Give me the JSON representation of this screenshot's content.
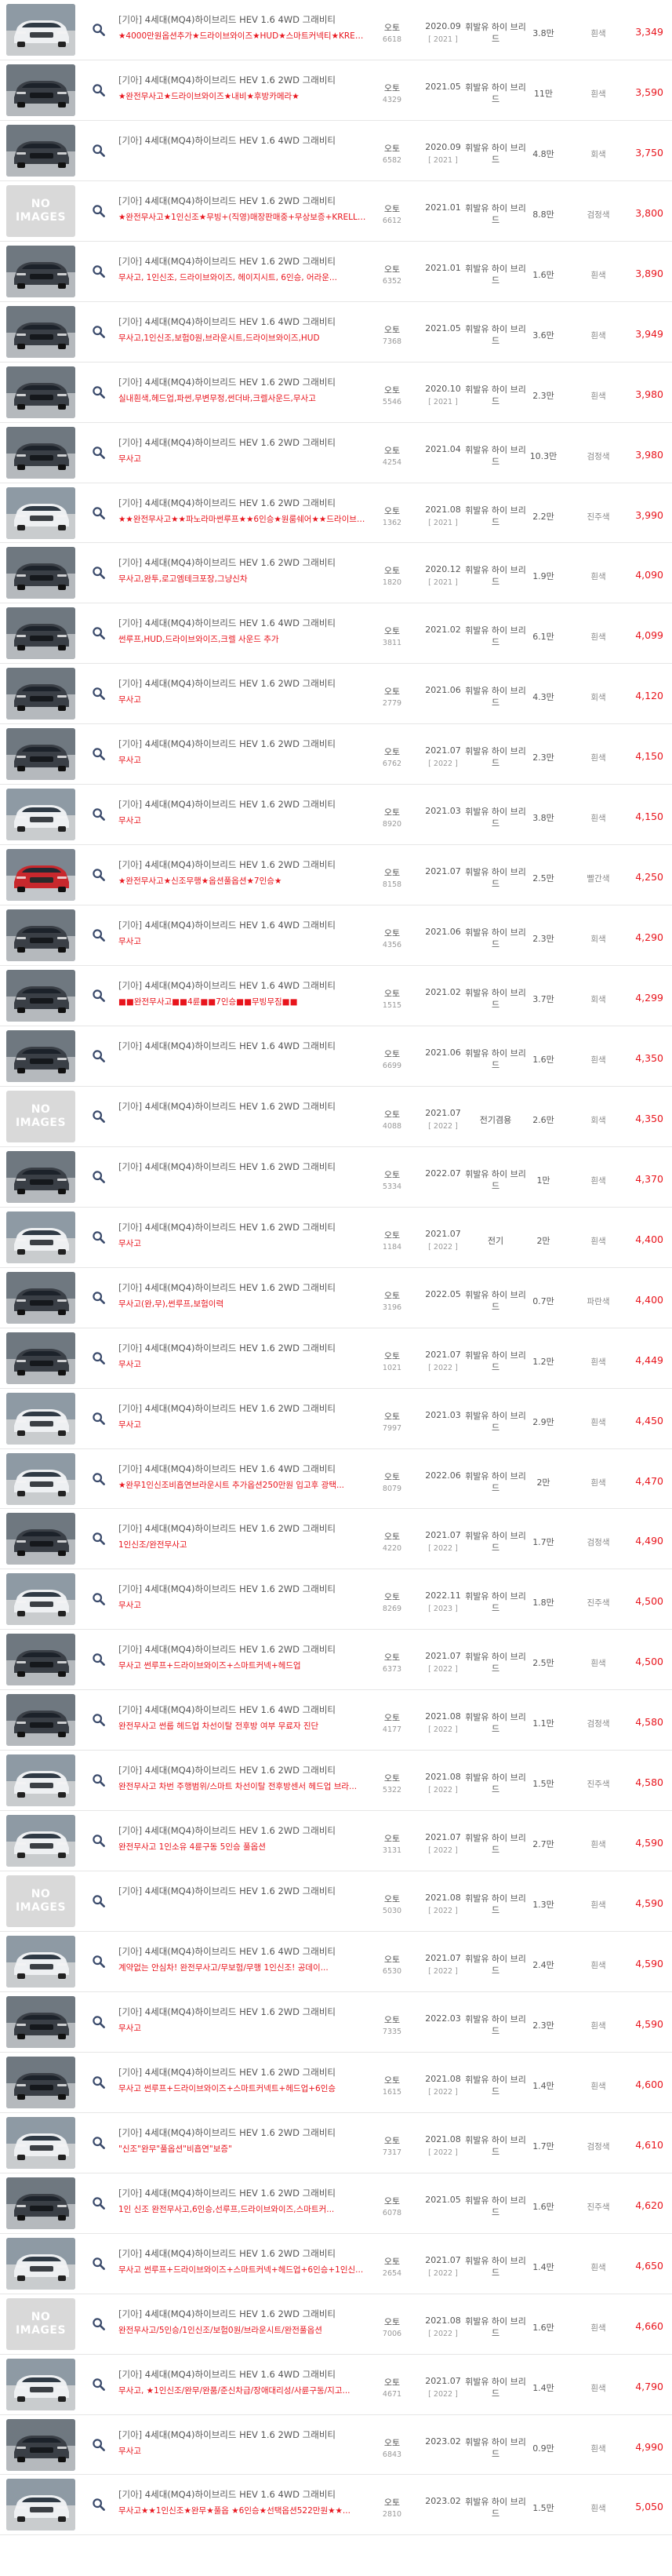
{
  "zoom_icon": "magnifier-icon",
  "no_image": {
    "line1": "NO",
    "line2": "IMAGES"
  },
  "listings": [
    {
      "photo": "white",
      "maker": "[기아]",
      "model": "4세대(MQ4)하이브리드 HEV 1.6 4WD 그래비티",
      "desc": "★4000만원옵션추가★드라이브와이즈★HUD★스마트커넥티★KRELL...",
      "trans": "오토",
      "sub": "6618",
      "year": "2020.09",
      "model_year": "[ 2021 ]",
      "fuel": "휘발유 하이 브리드",
      "km": "3.8만",
      "color": "흰색",
      "price": "3,349"
    },
    {
      "photo": "dark",
      "maker": "[기아]",
      "model": "4세대(MQ4)하이브리드 HEV 1.6 2WD 그래비티",
      "desc": "★완전무사고★드라이브와이즈★내비★후방카메라★",
      "trans": "오토",
      "sub": "4329",
      "year": "2021.05",
      "model_year": "",
      "fuel": "휘발유 하이 브리드",
      "km": "11만",
      "color": "흰색",
      "price": "3,590"
    },
    {
      "photo": "dark",
      "maker": "[기아]",
      "model": "4세대(MQ4)하이브리드 HEV 1.6 4WD 그래비티",
      "desc": "",
      "trans": "오토",
      "sub": "6582",
      "year": "2020.09",
      "model_year": "[ 2021 ]",
      "fuel": "휘발유 하이 브리드",
      "km": "4.8만",
      "color": "회색",
      "price": "3,750"
    },
    {
      "photo": "none",
      "maker": "[기아]",
      "model": "4세대(MQ4)하이브리드 HEV 1.6 2WD 그래비티",
      "desc": "★완전무사고★1인신조★무빙+(직영)매장판매중+무상보증+KRELL(디지털키포...",
      "trans": "오토",
      "sub": "6612",
      "year": "2021.01",
      "model_year": "",
      "fuel": "휘발유 하이 브리드",
      "km": "8.8만",
      "color": "검정색",
      "price": "3,800"
    },
    {
      "photo": "dark",
      "maker": "[기아]",
      "model": "4세대(MQ4)하이브리드 HEV 1.6 2WD 그래비티",
      "desc": "무사고, 1인신조, 드라이브와이즈, 헤이지시트, 6인승, 어라운...",
      "trans": "오토",
      "sub": "6352",
      "year": "2021.01",
      "model_year": "",
      "fuel": "휘발유 하이 브리드",
      "km": "1.6만",
      "color": "흰색",
      "price": "3,890"
    },
    {
      "photo": "dark",
      "maker": "[기아]",
      "model": "4세대(MQ4)하이브리드 HEV 1.6 4WD 그래비티",
      "desc": "무사고,1인신조,보험0원,브라운시트,드라이브와이즈,HUD",
      "trans": "오토",
      "sub": "7368",
      "year": "2021.05",
      "model_year": "",
      "fuel": "휘발유 하이 브리드",
      "km": "3.6만",
      "color": "흰색",
      "price": "3,949"
    },
    {
      "photo": "dark",
      "maker": "[기아]",
      "model": "4세대(MQ4)하이브리드 HEV 1.6 2WD 그래비티",
      "desc": "실내흰색,헤드업,파썬,무변무정,썬더바,크렐사운드,무사고",
      "trans": "오토",
      "sub": "5546",
      "year": "2020.10",
      "model_year": "[ 2021 ]",
      "fuel": "휘발유 하이 브리드",
      "km": "2.3만",
      "color": "흰색",
      "price": "3,980"
    },
    {
      "photo": "dark",
      "maker": "[기아]",
      "model": "4세대(MQ4)하이브리드 HEV 1.6 2WD 그래비티",
      "desc": "무사고",
      "trans": "오토",
      "sub": "4254",
      "year": "2021.04",
      "model_year": "",
      "fuel": "휘발유 하이 브리드",
      "km": "10.3만",
      "color": "검정색",
      "price": "3,980"
    },
    {
      "photo": "white",
      "maker": "[기아]",
      "model": "4세대(MQ4)하이브리드 HEV 1.6 2WD 그래비티",
      "desc": "★★완전무사고★★파노라마썬루프★★6인승★원룸쉐어★★드라이브와이...",
      "trans": "오토",
      "sub": "1362",
      "year": "2021.08",
      "model_year": "[ 2021 ]",
      "fuel": "휘발유 하이 브리드",
      "km": "2.2만",
      "color": "진주색",
      "price": "3,990"
    },
    {
      "photo": "dark",
      "maker": "[기아]",
      "model": "4세대(MQ4)하이브리드 HEV 1.6 2WD 그래비티",
      "desc": "무사고,완투,로고엠테크포장,그냥신차",
      "trans": "오토",
      "sub": "1820",
      "year": "2020.12",
      "model_year": "[ 2021 ]",
      "fuel": "휘발유 하이 브리드",
      "km": "1.9만",
      "color": "흰색",
      "price": "4,090"
    },
    {
      "photo": "dark",
      "maker": "[기아]",
      "model": "4세대(MQ4)하이브리드 HEV 1.6 4WD 그래비티",
      "desc": "썬루프,HUD,드라이브와이즈,크렐 사운드 추가",
      "trans": "오토",
      "sub": "3811",
      "year": "2021.02",
      "model_year": "",
      "fuel": "휘발유 하이 브리드",
      "km": "6.1만",
      "color": "흰색",
      "price": "4,099"
    },
    {
      "photo": "dark",
      "maker": "[기아]",
      "model": "4세대(MQ4)하이브리드 HEV 1.6 2WD 그래비티",
      "desc": "무사고",
      "trans": "오토",
      "sub": "2779",
      "year": "2021.06",
      "model_year": "",
      "fuel": "휘발유 하이 브리드",
      "km": "4.3만",
      "color": "회색",
      "price": "4,120"
    },
    {
      "photo": "dark",
      "maker": "[기아]",
      "model": "4세대(MQ4)하이브리드 HEV 1.6 2WD 그래비티",
      "desc": "무사고",
      "trans": "오토",
      "sub": "6762",
      "year": "2021.07",
      "model_year": "[ 2022 ]",
      "fuel": "휘발유 하이 브리드",
      "km": "2.3만",
      "color": "흰색",
      "price": "4,150"
    },
    {
      "photo": "white",
      "maker": "[기아]",
      "model": "4세대(MQ4)하이브리드 HEV 1.6 2WD 그래비티",
      "desc": "무사고",
      "trans": "오토",
      "sub": "8920",
      "year": "2021.03",
      "model_year": "",
      "fuel": "휘발유 하이 브리드",
      "km": "3.8만",
      "color": "흰색",
      "price": "4,150"
    },
    {
      "photo": "red",
      "maker": "[기아]",
      "model": "4세대(MQ4)하이브리드 HEV 1.6 2WD 그래비티",
      "desc": "★완전무사고★신조무행★옵션풀옵션★7인승★",
      "trans": "오토",
      "sub": "8158",
      "year": "2021.07",
      "model_year": "",
      "fuel": "휘발유 하이 브리드",
      "km": "2.5만",
      "color": "빨간색",
      "price": "4,250"
    },
    {
      "photo": "dark",
      "maker": "[기아]",
      "model": "4세대(MQ4)하이브리드 HEV 1.6 4WD 그래비티",
      "desc": "무사고",
      "trans": "오토",
      "sub": "4356",
      "year": "2021.06",
      "model_year": "",
      "fuel": "휘발유 하이 브리드",
      "km": "2.3만",
      "color": "회색",
      "price": "4,290"
    },
    {
      "photo": "dark",
      "maker": "[기아]",
      "model": "4세대(MQ4)하이브리드 HEV 1.6 4WD 그래비티",
      "desc": "■■완전무사고■■4륜■■7인승■■무빙무짐■■",
      "trans": "오토",
      "sub": "1515",
      "year": "2021.02",
      "model_year": "",
      "fuel": "휘발유 하이 브리드",
      "km": "3.7만",
      "color": "회색",
      "price": "4,299"
    },
    {
      "photo": "dark",
      "maker": "[기아]",
      "model": "4세대(MQ4)하이브리드 HEV 1.6 4WD 그래비티",
      "desc": "",
      "trans": "오토",
      "sub": "6699",
      "year": "2021.06",
      "model_year": "",
      "fuel": "휘발유 하이 브리드",
      "km": "1.6만",
      "color": "흰색",
      "price": "4,350"
    },
    {
      "photo": "none",
      "maker": "[기아]",
      "model": "4세대(MQ4)하이브리드 HEV 1.6 2WD 그래비티",
      "desc": "",
      "trans": "오토",
      "sub": "4088",
      "year": "2021.07",
      "model_year": "[ 2022 ]",
      "fuel": "전기겸용",
      "km": "2.6만",
      "color": "회색",
      "price": "4,350"
    },
    {
      "photo": "dark",
      "maker": "[기아]",
      "model": "4세대(MQ4)하이브리드 HEV 1.6 2WD 그래비티",
      "desc": "",
      "trans": "오토",
      "sub": "5334",
      "year": "2022.07",
      "model_year": "",
      "fuel": "휘발유 하이 브리드",
      "km": "1만",
      "color": "흰색",
      "price": "4,370"
    },
    {
      "photo": "white",
      "maker": "[기아]",
      "model": "4세대(MQ4)하이브리드 HEV 1.6 2WD 그래비티",
      "desc": "무사고",
      "trans": "오토",
      "sub": "1184",
      "year": "2021.07",
      "model_year": "[ 2022 ]",
      "fuel": "전기",
      "km": "2만",
      "color": "흰색",
      "price": "4,400"
    },
    {
      "photo": "dark",
      "maker": "[기아]",
      "model": "4세대(MQ4)하이브리드 HEV 1.6 2WD 그래비티",
      "desc": "무사고(완,무),썬루프,보험이력",
      "trans": "오토",
      "sub": "3196",
      "year": "2022.05",
      "model_year": "",
      "fuel": "휘발유 하이 브리드",
      "km": "0.7만",
      "color": "파란색",
      "price": "4,400"
    },
    {
      "photo": "dark",
      "maker": "[기아]",
      "model": "4세대(MQ4)하이브리드 HEV 1.6 2WD 그래비티",
      "desc": "무사고",
      "trans": "오토",
      "sub": "1021",
      "year": "2021.07",
      "model_year": "[ 2022 ]",
      "fuel": "휘발유 하이 브리드",
      "km": "1.2만",
      "color": "흰색",
      "price": "4,449"
    },
    {
      "photo": "white",
      "maker": "[기아]",
      "model": "4세대(MQ4)하이브리드 HEV 1.6 2WD 그래비티",
      "desc": "무사고",
      "trans": "오토",
      "sub": "7997",
      "year": "2021.03",
      "model_year": "",
      "fuel": "휘발유 하이 브리드",
      "km": "2.9만",
      "color": "흰색",
      "price": "4,450"
    },
    {
      "photo": "white",
      "maker": "[기아]",
      "model": "4세대(MQ4)하이브리드 HEV 1.6 4WD 그래비티",
      "desc": "★완무1인신조비흡연브라운시트 추가옵션250만원 입고후 광택...",
      "trans": "오토",
      "sub": "8079",
      "year": "2022.06",
      "model_year": "",
      "fuel": "휘발유 하이 브리드",
      "km": "2만",
      "color": "흰색",
      "price": "4,470"
    },
    {
      "photo": "dark",
      "maker": "[기아]",
      "model": "4세대(MQ4)하이브리드 HEV 1.6 2WD 그래비티",
      "desc": "1인신조/완전무사고",
      "trans": "오토",
      "sub": "4220",
      "year": "2021.07",
      "model_year": "[ 2022 ]",
      "fuel": "휘발유 하이 브리드",
      "km": "1.7만",
      "color": "검정색",
      "price": "4,490"
    },
    {
      "photo": "white",
      "maker": "[기아]",
      "model": "4세대(MQ4)하이브리드 HEV 1.6 2WD 그래비티",
      "desc": "무사고",
      "trans": "오토",
      "sub": "8269",
      "year": "2022.11",
      "model_year": "[ 2023 ]",
      "fuel": "휘발유 하이 브리드",
      "km": "1.8만",
      "color": "진주색",
      "price": "4,500"
    },
    {
      "photo": "dark",
      "maker": "[기아]",
      "model": "4세대(MQ4)하이브리드 HEV 1.6 2WD 그래비티",
      "desc": "무사고 썬루프+드라이브와이즈+스마트커넥+헤드업",
      "trans": "오토",
      "sub": "6373",
      "year": "2021.07",
      "model_year": "[ 2022 ]",
      "fuel": "휘발유 하이 브리드",
      "km": "2.5만",
      "color": "흰색",
      "price": "4,500"
    },
    {
      "photo": "dark",
      "maker": "[기아]",
      "model": "4세대(MQ4)하이브리드 HEV 1.6 4WD 그래비티",
      "desc": "완전무사고 썬룹 헤드업 차선이탈 전후방 여부 무료자 진단",
      "trans": "오토",
      "sub": "4177",
      "year": "2021.08",
      "model_year": "[ 2022 ]",
      "fuel": "휘발유 하이 브리드",
      "km": "1.1만",
      "color": "검정색",
      "price": "4,580"
    },
    {
      "photo": "white",
      "maker": "[기아]",
      "model": "4세대(MQ4)하이브리드 HEV 1.6 2WD 그래비티",
      "desc": "완전무사고 차번 주행범위/스마트 차선이탈 전후방센서 헤드업 브라...",
      "trans": "오토",
      "sub": "5322",
      "year": "2021.08",
      "model_year": "[ 2022 ]",
      "fuel": "휘발유 하이 브리드",
      "km": "1.5만",
      "color": "진주색",
      "price": "4,580"
    },
    {
      "photo": "white",
      "maker": "[기아]",
      "model": "4세대(MQ4)하이브리드 HEV 1.6 2WD 그래비티",
      "desc": "완전무사고 1인소유 4륜구동 5인승 풀옵션",
      "trans": "오토",
      "sub": "3131",
      "year": "2021.07",
      "model_year": "[ 2022 ]",
      "fuel": "휘발유 하이 브리드",
      "km": "2.7만",
      "color": "흰색",
      "price": "4,590"
    },
    {
      "photo": "none",
      "maker": "[기아]",
      "model": "4세대(MQ4)하이브리드 HEV 1.6 2WD 그래비티",
      "desc": "",
      "trans": "오토",
      "sub": "5030",
      "year": "2021.08",
      "model_year": "[ 2022 ]",
      "fuel": "휘발유 하이 브리드",
      "km": "1.3만",
      "color": "흰색",
      "price": "4,590"
    },
    {
      "photo": "white",
      "maker": "[기아]",
      "model": "4세대(MQ4)하이브리드 HEV 1.6 4WD 그래비티",
      "desc": "계약없는 안심차! 완전무사고/무보험/무행 1인신조! 공데이...",
      "trans": "오토",
      "sub": "6530",
      "year": "2021.07",
      "model_year": "[ 2022 ]",
      "fuel": "휘발유 하이 브리드",
      "km": "2.4만",
      "color": "흰색",
      "price": "4,590"
    },
    {
      "photo": "dark",
      "maker": "[기아]",
      "model": "4세대(MQ4)하이브리드 HEV 1.6 2WD 그래비티",
      "desc": "무사고",
      "trans": "오토",
      "sub": "7335",
      "year": "2022.03",
      "model_year": "",
      "fuel": "휘발유 하이 브리드",
      "km": "2.3만",
      "color": "흰색",
      "price": "4,590"
    },
    {
      "photo": "dark",
      "maker": "[기아]",
      "model": "4세대(MQ4)하이브리드 HEV 1.6 2WD 그래비티",
      "desc": "무사고 썬루프+드라이브와이즈+스마트커넥트+헤드업+6인승",
      "trans": "오토",
      "sub": "1615",
      "year": "2021.08",
      "model_year": "[ 2022 ]",
      "fuel": "휘발유 하이 브리드",
      "km": "1.4만",
      "color": "흰색",
      "price": "4,600"
    },
    {
      "photo": "white",
      "maker": "[기아]",
      "model": "4세대(MQ4)하이브리드 HEV 1.6 2WD 그래비티",
      "desc": "\"신조\"완무\"풀옵션\"비흡연\"보증\"",
      "trans": "오토",
      "sub": "7317",
      "year": "2021.08",
      "model_year": "[ 2022 ]",
      "fuel": "휘발유 하이 브리드",
      "km": "1.7만",
      "color": "검정색",
      "price": "4,610"
    },
    {
      "photo": "dark",
      "maker": "[기아]",
      "model": "4세대(MQ4)하이브리드 HEV 1.6 2WD 그래비티",
      "desc": "1인 신조 완전무사고,6인승,선루프,드라이브와이즈,스마트커...",
      "trans": "오토",
      "sub": "6078",
      "year": "2021.05",
      "model_year": "",
      "fuel": "휘발유 하이 브리드",
      "km": "1.6만",
      "color": "진주색",
      "price": "4,620"
    },
    {
      "photo": "white",
      "maker": "[기아]",
      "model": "4세대(MQ4)하이브리드 HEV 1.6 2WD 그래비티",
      "desc": "무사고 썬루프+드라이브와이즈+스마트커넥+헤드업+6인승+1인신...",
      "trans": "오토",
      "sub": "2654",
      "year": "2021.07",
      "model_year": "[ 2022 ]",
      "fuel": "휘발유 하이 브리드",
      "km": "1.4만",
      "color": "흰색",
      "price": "4,650"
    },
    {
      "photo": "none",
      "maker": "[기아]",
      "model": "4세대(MQ4)하이브리드 HEV 1.6 2WD 그래비티",
      "desc": "완전무사고/5인승/1인신조/보험0원/브라운시트/완전풀옵션",
      "trans": "오토",
      "sub": "7006",
      "year": "2021.08",
      "model_year": "[ 2022 ]",
      "fuel": "휘발유 하이 브리드",
      "km": "1.6만",
      "color": "흰색",
      "price": "4,660"
    },
    {
      "photo": "white",
      "maker": "[기아]",
      "model": "4세대(MQ4)하이브리드 HEV 1.6 4WD 그래비티",
      "desc": "무사고, ★1인신조/완무/완품/준신차급/장애대리성/사륜구동/지고...",
      "trans": "오토",
      "sub": "4671",
      "year": "2021.07",
      "model_year": "[ 2022 ]",
      "fuel": "휘발유 하이 브리드",
      "km": "1.4만",
      "color": "흰색",
      "price": "4,790"
    },
    {
      "photo": "dark",
      "maker": "[기아]",
      "model": "4세대(MQ4)하이브리드 HEV 1.6 2WD 그래비티",
      "desc": "무사고",
      "trans": "오토",
      "sub": "6843",
      "year": "2023.02",
      "model_year": "",
      "fuel": "휘발유 하이 브리드",
      "km": "0.9만",
      "color": "흰색",
      "price": "4,990"
    },
    {
      "photo": "white",
      "maker": "[기아]",
      "model": "4세대(MQ4)하이브리드 HEV 1.6 4WD 그래비티",
      "desc": "무사고★★1인신조★완무★풀옵 ★6인승★선택옵션522만원★★...",
      "trans": "오토",
      "sub": "2810",
      "year": "2023.02",
      "model_year": "",
      "fuel": "휘발유 하이 브리드",
      "km": "1.5만",
      "color": "흰색",
      "price": "5,050"
    }
  ]
}
